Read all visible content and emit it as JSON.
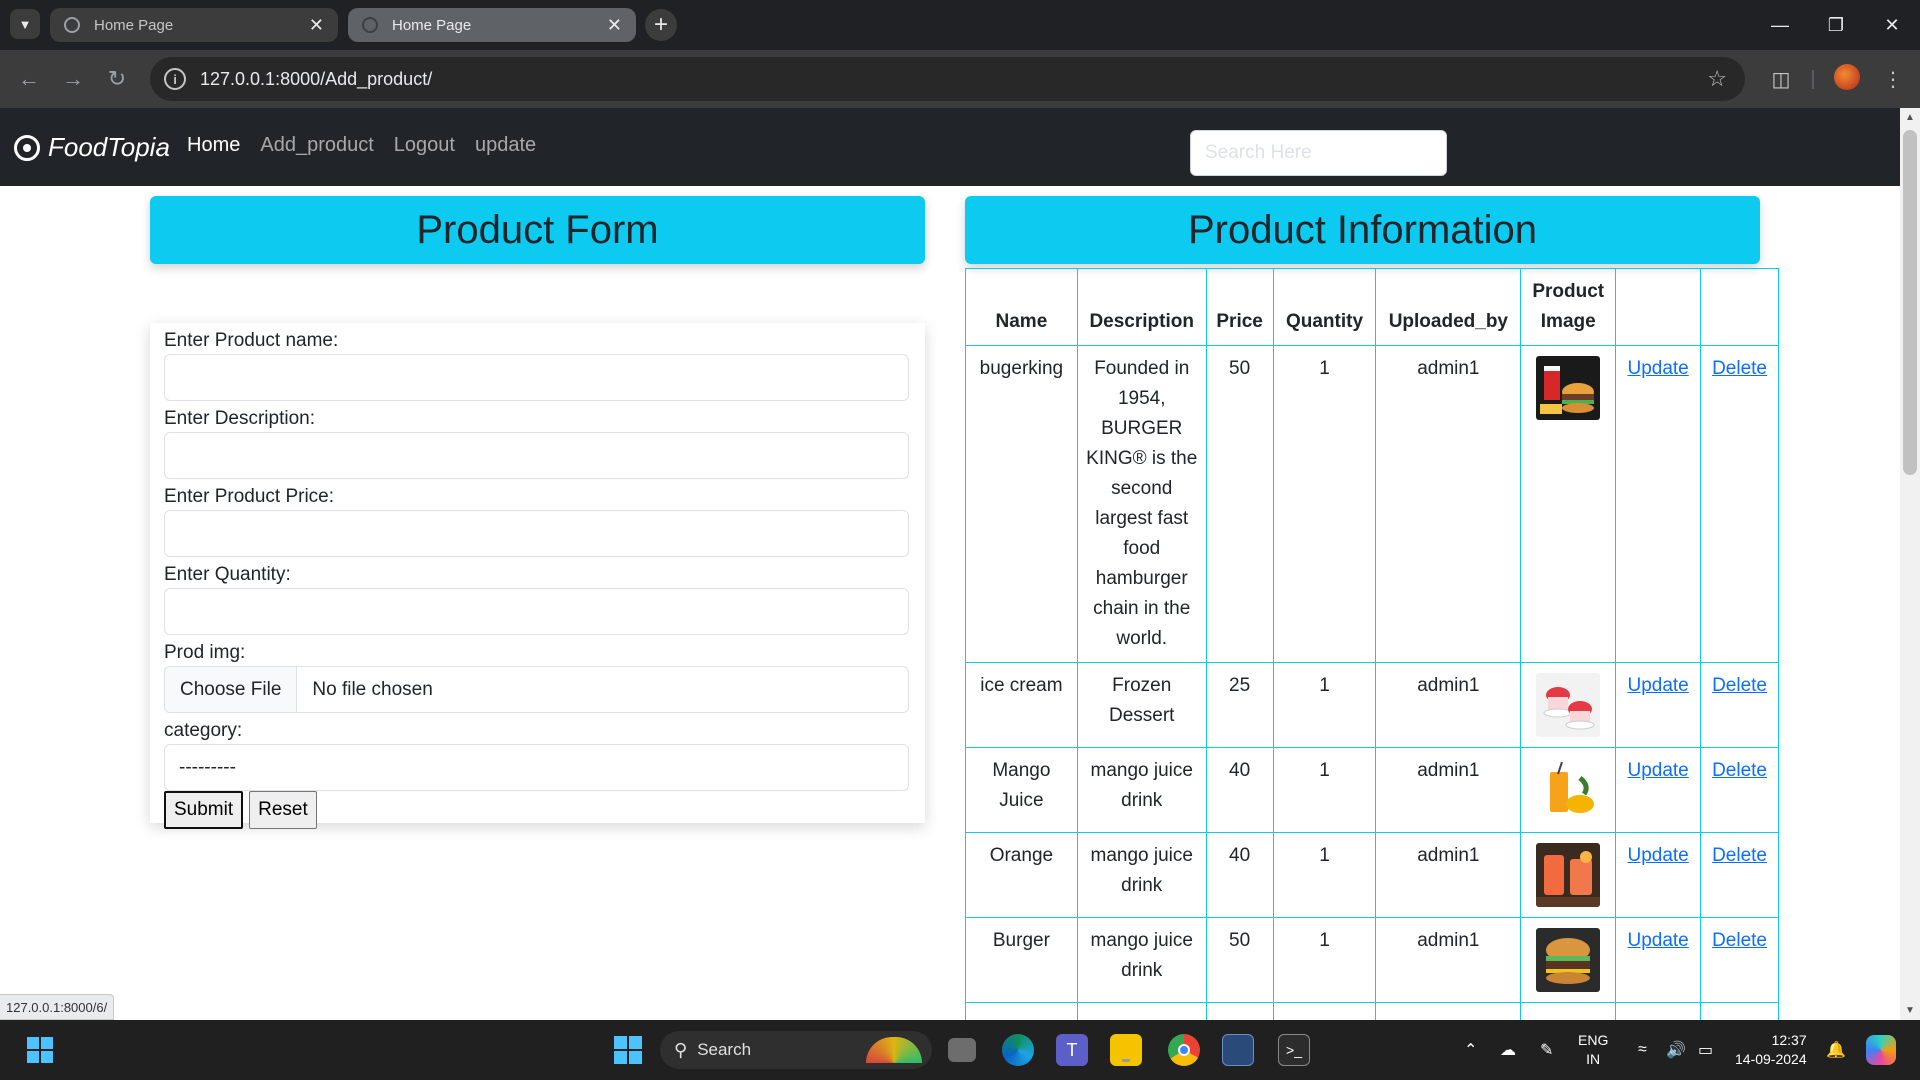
{
  "browser": {
    "tabs": [
      {
        "title": "Home Page",
        "active": true
      },
      {
        "title": "Home Page",
        "active": false
      }
    ],
    "new_tab_symbol": "+",
    "url": "127.0.0.1:8000/Add_product/",
    "status_url": "127.0.0.1:8000/6/"
  },
  "navbar": {
    "brand": "FoodTopia",
    "links": [
      "Home",
      "Add_product",
      "Logout",
      "update"
    ],
    "search_placeholder": "Search Here"
  },
  "form": {
    "heading": "Product Form",
    "labels": {
      "name": "Enter Product name:",
      "description": "Enter Description:",
      "price": "Enter Product Price:",
      "quantity": "Enter Quantity:",
      "image": "Prod img:",
      "category": "category:"
    },
    "file_button": "Choose File",
    "file_status": "No file chosen",
    "category_value": "---------",
    "submit": "Submit",
    "reset": "Reset"
  },
  "table": {
    "heading": "Product Information",
    "columns": [
      "Name",
      "Description",
      "Price",
      "Quantity",
      "Uploaded_by",
      "Product Image",
      "",
      ""
    ],
    "rows": [
      {
        "name": "bugerking",
        "description": "Founded in 1954, BURGER KING® is the second largest fast food hamburger chain in the world.",
        "price": "50",
        "quantity": "1",
        "uploaded_by": "admin1",
        "image": "burger-meal-image",
        "update": "Update",
        "delete": "Delete"
      },
      {
        "name": "ice cream",
        "description": "Frozen Dessert",
        "price": "25",
        "quantity": "1",
        "uploaded_by": "admin1",
        "image": "ice-cream-image",
        "update": "Update",
        "delete": "Delete"
      },
      {
        "name": "Mango Juice",
        "description": "mango juice drink",
        "price": "40",
        "quantity": "1",
        "uploaded_by": "admin1",
        "image": "mango-juice-image",
        "update": "Update",
        "delete": "Delete"
      },
      {
        "name": "Orange",
        "description": "mango juice drink",
        "price": "40",
        "quantity": "1",
        "uploaded_by": "admin1",
        "image": "orange-drink-image",
        "update": "Update",
        "delete": "Delete"
      },
      {
        "name": "Burger",
        "description": "mango juice drink",
        "price": "50",
        "quantity": "1",
        "uploaded_by": "admin1",
        "image": "burger-image",
        "update": "Update",
        "delete": "Delete"
      }
    ]
  },
  "taskbar": {
    "search_label": "Search",
    "lang_line1": "ENG",
    "lang_line2": "IN",
    "time": "12:37",
    "date": "14-09-2024"
  },
  "colors": {
    "accent": "#0dcaf0",
    "navbar_bg": "#212529",
    "link": "#0d6efd"
  }
}
